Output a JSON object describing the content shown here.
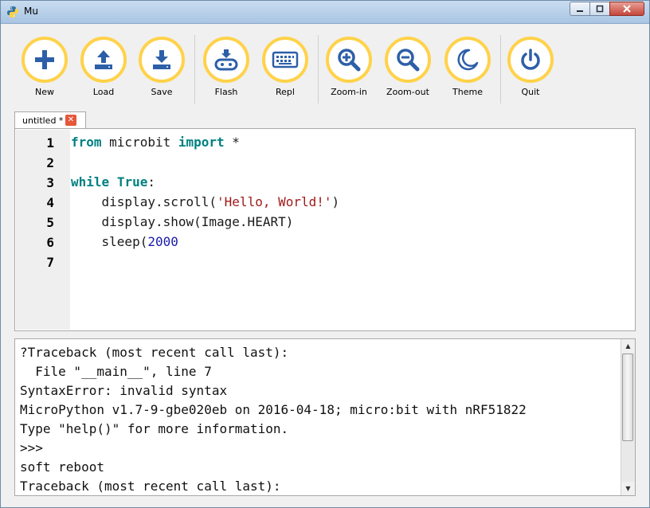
{
  "window": {
    "title": "Mu"
  },
  "toolbar": {
    "buttons": [
      {
        "label": "New",
        "icon": "plus-icon"
      },
      {
        "label": "Load",
        "icon": "upload-icon"
      },
      {
        "label": "Save",
        "icon": "download-icon"
      },
      {
        "label": "Flash",
        "icon": "microbit-flash-icon"
      },
      {
        "label": "Repl",
        "icon": "keyboard-icon"
      },
      {
        "label": "Zoom-in",
        "icon": "zoom-in-icon"
      },
      {
        "label": "Zoom-out",
        "icon": "zoom-out-icon"
      },
      {
        "label": "Theme",
        "icon": "moon-icon"
      },
      {
        "label": "Quit",
        "icon": "power-icon"
      }
    ]
  },
  "tabs": [
    {
      "label": "untitled *",
      "close": "✕"
    }
  ],
  "editor": {
    "line_numbers": [
      "1",
      "2",
      "3",
      "4",
      "5",
      "6",
      "7"
    ],
    "lines": [
      [
        "from",
        " microbit ",
        "import",
        " *"
      ],
      [],
      [
        "while",
        " ",
        "True",
        ":"
      ],
      [
        "    display.scroll(",
        "'Hello, World!'",
        ")"
      ],
      [
        "    display.show(Image.HEART)"
      ],
      [
        "    sleep(",
        "2000"
      ],
      []
    ]
  },
  "repl": {
    "lines": [
      "?Traceback (most recent call last):",
      "  File \"__main__\", line 7",
      "SyntaxError: invalid syntax",
      "MicroPython v1.7-9-gbe020eb on 2016-04-18; micro:bit with nRF51822",
      "Type \"help()\" for more information.",
      ">>>",
      "soft reboot",
      "Traceback (most recent call last):"
    ]
  },
  "colors": {
    "accent_ring": "#ffd24a",
    "icon": "#2d5fa8",
    "keyword": "#008080",
    "string": "#a01a1a",
    "number": "#1a1aa8"
  }
}
